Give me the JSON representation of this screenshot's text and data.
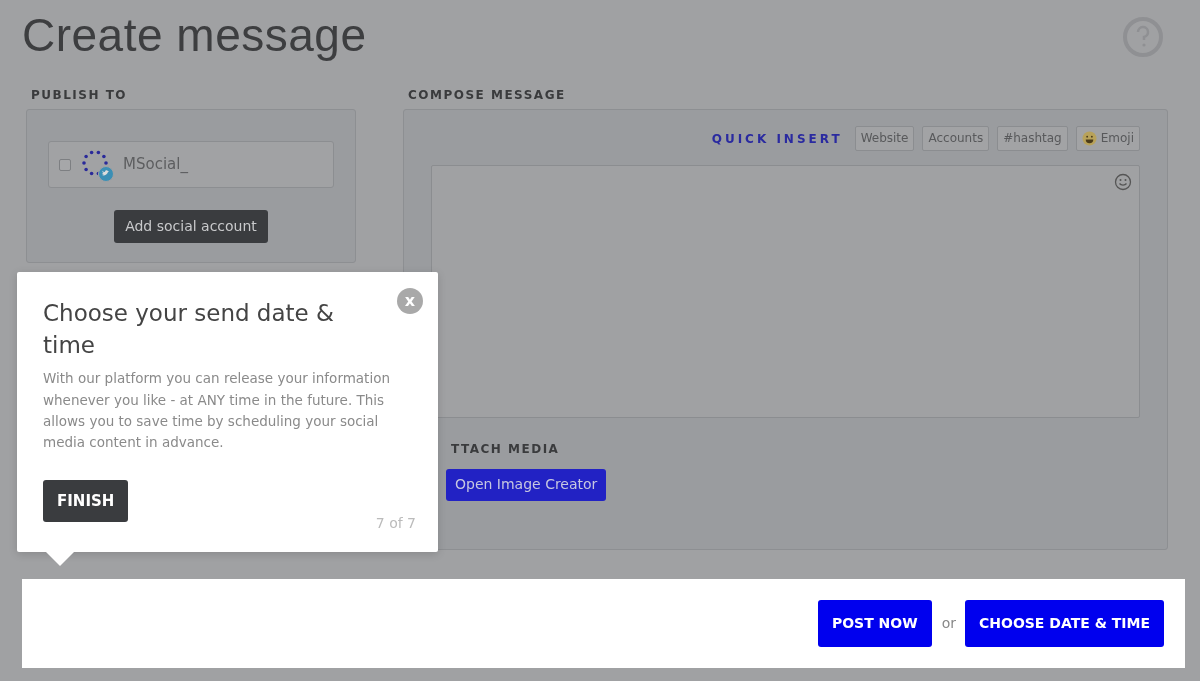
{
  "page": {
    "title": "Create message"
  },
  "publish_to": {
    "heading": "PUBLISH TO",
    "accounts": [
      {
        "name": "MSocial_",
        "checked": false
      }
    ],
    "add_button": "Add social account"
  },
  "compose": {
    "heading": "COMPOSE MESSAGE",
    "quick_insert_label": "QUICK INSERT",
    "quick_insert": [
      {
        "label": "Website",
        "kind": "text"
      },
      {
        "label": "Accounts",
        "kind": "text"
      },
      {
        "label": "#hashtag",
        "kind": "text"
      },
      {
        "label": "Emoji",
        "kind": "emoji"
      }
    ]
  },
  "attach_media": {
    "heading": "TTACH MEDIA",
    "button": "Open Image Creator"
  },
  "tour_popover": {
    "title": "Choose your send date & time",
    "body": "With our platform you can release your information whenever you like - at ANY time in the future. This allows you to save time by scheduling your social media content in advance.",
    "close": "x",
    "finish": "FINISH",
    "step": "7 of 7"
  },
  "footer": {
    "post_now": "POST NOW",
    "separator": "or",
    "schedule": "CHOOSE DATE & TIME"
  }
}
